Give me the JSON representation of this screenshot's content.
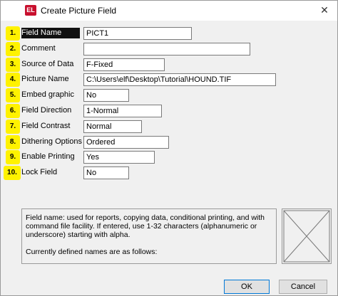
{
  "window": {
    "title": "Create Picture Field",
    "app_icon_text": "EL",
    "close_glyph": "✕"
  },
  "fields": [
    {
      "number": "1.",
      "label": "Field Name",
      "value": "PICT1"
    },
    {
      "number": "2.",
      "label": "Comment",
      "value": ""
    },
    {
      "number": "3.",
      "label": "Source of Data",
      "value": "F-Fixed"
    },
    {
      "number": "4.",
      "label": "Picture Name",
      "value": "C:\\Users\\elf\\Desktop\\Tutorial\\HOUND.TIF"
    },
    {
      "number": "5.",
      "label": "Embed graphic",
      "value": "No"
    },
    {
      "number": "6.",
      "label": "Field Direction",
      "value": "1-Normal"
    },
    {
      "number": "7.",
      "label": "Field Contrast",
      "value": "Normal"
    },
    {
      "number": "8.",
      "label": "Dithering Options",
      "value": "Ordered"
    },
    {
      "number": "9.",
      "label": "Enable Printing",
      "value": "Yes"
    },
    {
      "number": "10.",
      "label": "Lock Field",
      "value": "No"
    }
  ],
  "help": {
    "lines": [
      "Field name: used for reports, copying data, conditional printing, and with",
      "command file facility. If entered, use 1-32 characters (alphanumeric or",
      "underscore) starting with alpha.",
      "Currently defined names are as follows:"
    ]
  },
  "buttons": {
    "ok": "OK",
    "cancel": "Cancel"
  },
  "colors": {
    "badge": "#fff200",
    "selected_label_bg": "#111111",
    "app_icon": "#c8102e"
  }
}
